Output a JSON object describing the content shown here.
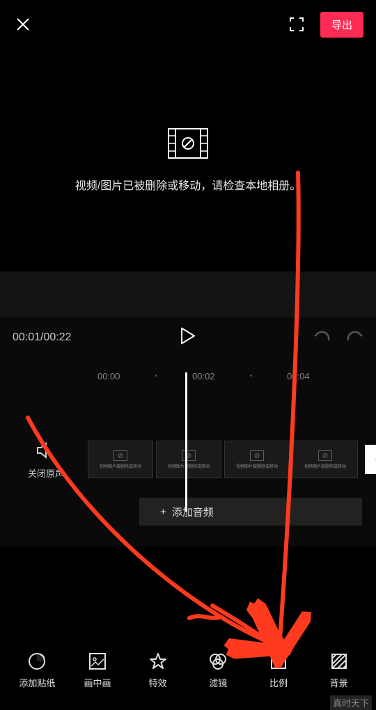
{
  "header": {
    "export_label": "导出"
  },
  "preview": {
    "error_text": "视频/图片已被删除或移动，请检查本地相册。"
  },
  "player": {
    "current_time": "00:01",
    "total_time": "00:22"
  },
  "timeline": {
    "ticks": [
      "00:00",
      "00:02",
      "00:04"
    ],
    "clip_error_short": "视频图片被删除或移动",
    "mute_label": "关闭原声",
    "add_audio_label": "添加音频",
    "add_clip_label": "+"
  },
  "toolbar": {
    "items": [
      {
        "id": "sticker",
        "label": "添加贴纸"
      },
      {
        "id": "pip",
        "label": "画中画"
      },
      {
        "id": "effects",
        "label": "特效"
      },
      {
        "id": "filter",
        "label": "滤镜"
      },
      {
        "id": "ratio",
        "label": "比例"
      },
      {
        "id": "background",
        "label": "背景"
      }
    ]
  },
  "watermark": "真时天下",
  "colors": {
    "accent": "#fe2c55",
    "annotation": "#ff3a1f"
  }
}
